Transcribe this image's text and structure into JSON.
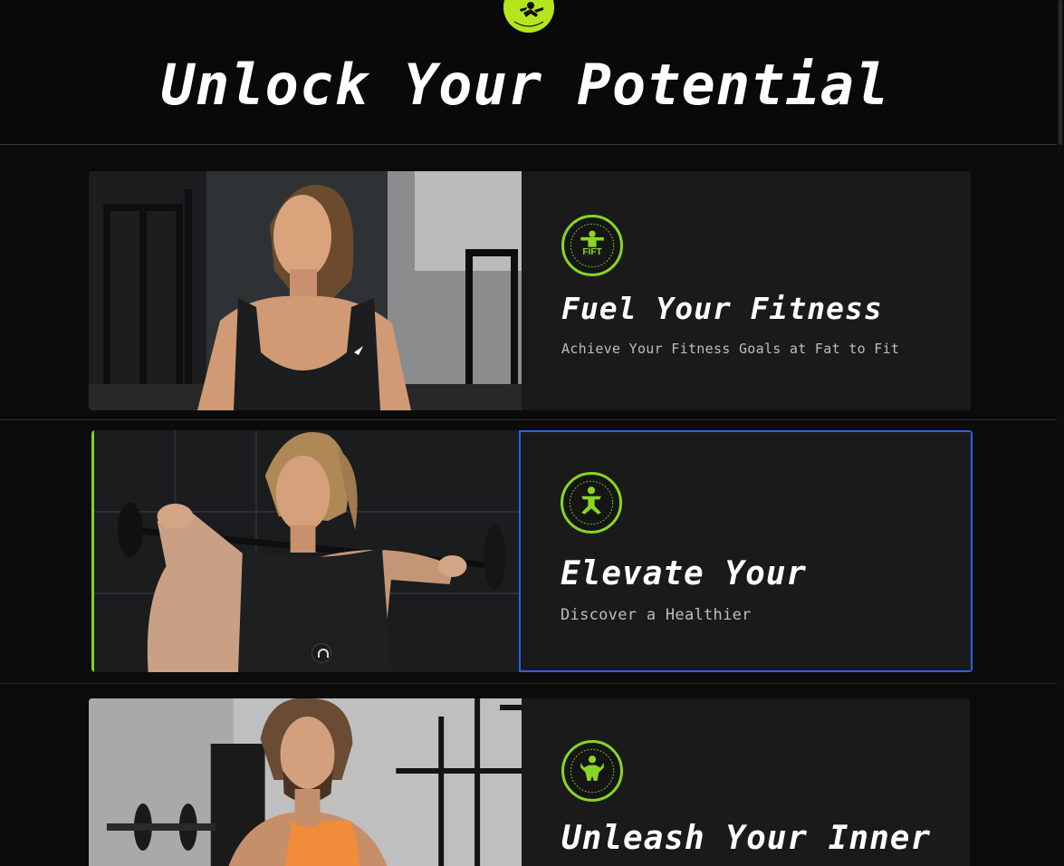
{
  "header": {
    "logo_icon": "fitness-runner-logo-icon",
    "title": "Unlock Your Potential"
  },
  "cards": [
    {
      "image_alt": "woman-in-gym-photo",
      "badge_icon": "fift-gym-badge-icon",
      "badge_text": "FIFT",
      "title": "Fuel Your Fitness",
      "subtitle": "Achieve Your Fitness Goals at Fat to Fit"
    },
    {
      "image_alt": "woman-lifting-barbell-photo",
      "badge_icon": "squatting-athlete-badge-icon",
      "title": "Elevate Your",
      "subtitle": "Discover a Healthier"
    },
    {
      "image_alt": "man-lifting-dumbbell-photo",
      "badge_icon": "flexing-athlete-badge-icon",
      "title": "Unleash Your Inner"
    }
  ],
  "colors": {
    "background": "#0a0a0a",
    "card_bg": "#1a1a1a",
    "accent_green": "#8bd424",
    "focus_blue": "#2563eb"
  }
}
